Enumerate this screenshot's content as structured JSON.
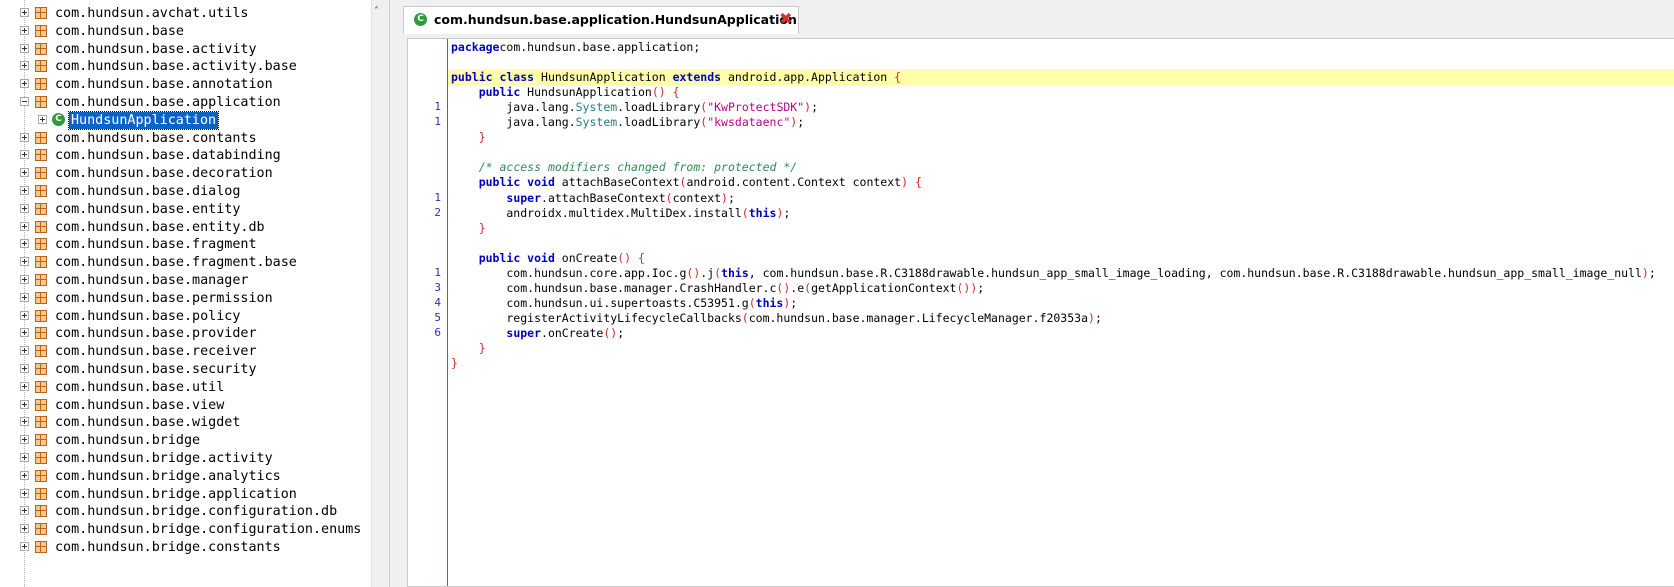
{
  "tree": {
    "items": [
      {
        "label": "com.hundsun.avchat.utils",
        "expanded": false
      },
      {
        "label": "com.hundsun.base",
        "expanded": false
      },
      {
        "label": "com.hundsun.base.activity",
        "expanded": false
      },
      {
        "label": "com.hundsun.base.activity.base",
        "expanded": false
      },
      {
        "label": "com.hundsun.base.annotation",
        "expanded": false
      },
      {
        "label": "com.hundsun.base.application",
        "expanded": true
      },
      {
        "label": "HundsunApplication",
        "type": "class",
        "selected": true
      },
      {
        "label": "com.hundsun.base.contants",
        "expanded": false
      },
      {
        "label": "com.hundsun.base.databinding",
        "expanded": false
      },
      {
        "label": "com.hundsun.base.decoration",
        "expanded": false
      },
      {
        "label": "com.hundsun.base.dialog",
        "expanded": false
      },
      {
        "label": "com.hundsun.base.entity",
        "expanded": false
      },
      {
        "label": "com.hundsun.base.entity.db",
        "expanded": false
      },
      {
        "label": "com.hundsun.base.fragment",
        "expanded": false
      },
      {
        "label": "com.hundsun.base.fragment.base",
        "expanded": false
      },
      {
        "label": "com.hundsun.base.manager",
        "expanded": false
      },
      {
        "label": "com.hundsun.base.permission",
        "expanded": false
      },
      {
        "label": "com.hundsun.base.policy",
        "expanded": false
      },
      {
        "label": "com.hundsun.base.provider",
        "expanded": false
      },
      {
        "label": "com.hundsun.base.receiver",
        "expanded": false
      },
      {
        "label": "com.hundsun.base.security",
        "expanded": false
      },
      {
        "label": "com.hundsun.base.util",
        "expanded": false
      },
      {
        "label": "com.hundsun.base.view",
        "expanded": false
      },
      {
        "label": "com.hundsun.base.wigdet",
        "expanded": false
      },
      {
        "label": "com.hundsun.bridge",
        "expanded": false
      },
      {
        "label": "com.hundsun.bridge.activity",
        "expanded": false
      },
      {
        "label": "com.hundsun.bridge.analytics",
        "expanded": false
      },
      {
        "label": "com.hundsun.bridge.application",
        "expanded": false
      },
      {
        "label": "com.hundsun.bridge.configuration.db",
        "expanded": false
      },
      {
        "label": "com.hundsun.bridge.configuration.enums",
        "expanded": false
      },
      {
        "label": "com.hundsun.bridge.constants",
        "expanded": false
      }
    ]
  },
  "editor": {
    "tab_title": "com.hundsun.base.application.HundsunApplication",
    "tab_close_glyph": "✖",
    "class_icon_glyph": "C",
    "lines": [
      {
        "ln": "",
        "tokens": [
          [
            "kw",
            "package"
          ],
          [
            "",
            "com.hundsun.base.application;"
          ]
        ]
      },
      {
        "ln": "",
        "tokens": []
      },
      {
        "ln": "",
        "tokens": [
          [
            "kw",
            "public class"
          ],
          [
            "",
            " HundsunApplication "
          ],
          [
            "kw",
            "extends"
          ],
          [
            "",
            " android.app.Application "
          ],
          [
            "br",
            "{"
          ]
        ]
      },
      {
        "ln": "",
        "tokens": [
          [
            "",
            "    "
          ],
          [
            "kw",
            "public"
          ],
          [
            "",
            " HundsunApplication"
          ],
          [
            "br",
            "()"
          ],
          [
            "",
            " "
          ],
          [
            "br",
            "{"
          ]
        ]
      },
      {
        "ln": "1",
        "tokens": [
          [
            "",
            "        java.lang."
          ],
          [
            "cls",
            "System"
          ],
          [
            "",
            ".loadLibrary"
          ],
          [
            "br",
            "("
          ],
          [
            "str",
            "\"KwProtectSDK\""
          ],
          [
            "br",
            ")"
          ],
          [
            "",
            ";"
          ]
        ]
      },
      {
        "ln": "1",
        "tokens": [
          [
            "",
            "        java.lang."
          ],
          [
            "cls",
            "System"
          ],
          [
            "",
            ".loadLibrary"
          ],
          [
            "br",
            "("
          ],
          [
            "str",
            "\"kwsdataenc\""
          ],
          [
            "br",
            ")"
          ],
          [
            "",
            ";"
          ]
        ]
      },
      {
        "ln": "",
        "tokens": [
          [
            "",
            "    "
          ],
          [
            "br",
            "}"
          ]
        ]
      },
      {
        "ln": "",
        "tokens": []
      },
      {
        "ln": "",
        "tokens": [
          [
            "",
            "    "
          ],
          [
            "cmt",
            "/* access modifiers changed from: protected */"
          ]
        ]
      },
      {
        "ln": "",
        "tokens": [
          [
            "",
            "    "
          ],
          [
            "kw",
            "public void"
          ],
          [
            "",
            " attachBaseContext"
          ],
          [
            "br",
            "("
          ],
          [
            "",
            "android.content.Context context"
          ],
          [
            "br",
            ")"
          ],
          [
            "",
            " "
          ],
          [
            "br",
            "{"
          ]
        ]
      },
      {
        "ln": "1",
        "tokens": [
          [
            "",
            "        "
          ],
          [
            "kw",
            "super"
          ],
          [
            "",
            ".attachBaseContext"
          ],
          [
            "br",
            "("
          ],
          [
            "",
            "context"
          ],
          [
            "br",
            ")"
          ],
          [
            "",
            ";"
          ]
        ]
      },
      {
        "ln": "2",
        "tokens": [
          [
            "",
            "        androidx.multidex.MultiDex.install"
          ],
          [
            "br",
            "("
          ],
          [
            "kw",
            "this"
          ],
          [
            "br",
            ")"
          ],
          [
            "",
            ";"
          ]
        ]
      },
      {
        "ln": "",
        "tokens": [
          [
            "",
            "    "
          ],
          [
            "br",
            "}"
          ]
        ]
      },
      {
        "ln": "",
        "tokens": []
      },
      {
        "ln": "",
        "tokens": [
          [
            "",
            "    "
          ],
          [
            "kw",
            "public void"
          ],
          [
            "",
            " onCreate"
          ],
          [
            "br",
            "()"
          ],
          [
            "",
            " "
          ],
          [
            "br",
            "{"
          ]
        ]
      },
      {
        "ln": "1",
        "tokens": [
          [
            "",
            "        com.hundsun.core.app.Ioc.g"
          ],
          [
            "br",
            "()"
          ],
          [
            "",
            ".j"
          ],
          [
            "br",
            "("
          ],
          [
            "kw",
            "this"
          ],
          [
            "",
            ", com.hundsun.base.R.C3188drawable.hundsun_app_small_image_loading, com.hundsun.base.R.C3188drawable.hundsun_app_small_image_null"
          ],
          [
            "br",
            ")"
          ],
          [
            "",
            ";"
          ]
        ]
      },
      {
        "ln": "3",
        "tokens": [
          [
            "",
            "        com.hundsun.base.manager.CrashHandler.c"
          ],
          [
            "br",
            "()"
          ],
          [
            "",
            ".e"
          ],
          [
            "br",
            "("
          ],
          [
            "",
            "getApplicationContext"
          ],
          [
            "br",
            "())"
          ],
          [
            "",
            ";"
          ]
        ]
      },
      {
        "ln": "4",
        "tokens": [
          [
            "",
            "        com.hundsun.ui.supertoasts.C53951.g"
          ],
          [
            "br",
            "("
          ],
          [
            "kw",
            "this"
          ],
          [
            "br",
            ")"
          ],
          [
            "",
            ";"
          ]
        ]
      },
      {
        "ln": "5",
        "tokens": [
          [
            "",
            "        registerActivityLifecycleCallbacks"
          ],
          [
            "br",
            "("
          ],
          [
            "",
            "com.hundsun.base.manager.LifecycleManager.f20353a"
          ],
          [
            "br",
            ")"
          ],
          [
            "",
            ";"
          ]
        ]
      },
      {
        "ln": "6",
        "tokens": [
          [
            "",
            "        "
          ],
          [
            "kw",
            "super"
          ],
          [
            "",
            ".onCreate"
          ],
          [
            "br",
            "()"
          ],
          [
            "",
            ";"
          ]
        ]
      },
      {
        "ln": "",
        "tokens": [
          [
            "",
            "    "
          ],
          [
            "br",
            "}"
          ]
        ]
      },
      {
        "ln": "",
        "tokens": [
          [
            "br",
            "}"
          ]
        ]
      }
    ]
  }
}
